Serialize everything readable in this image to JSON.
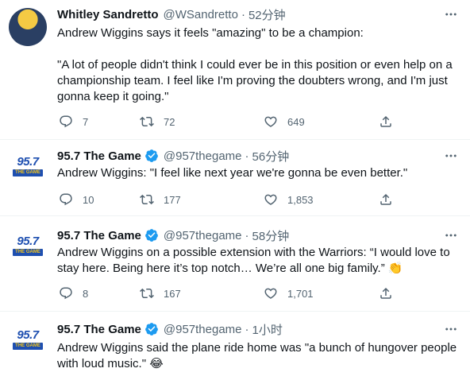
{
  "tweets": [
    {
      "name": "Whitley Sandretto",
      "handle": "@WSandretto",
      "separator": "·",
      "time": "52分钟",
      "text": "Andrew Wiggins says it feels \"amazing\" to be a champion:\n\n\"A lot of people didn't think I could ever be in this position or even help on a championship team. I feel like I'm proving the doubters wrong, and I'm just gonna keep it going.\"",
      "replies": "7",
      "retweets": "72",
      "likes": "649",
      "avatar_icon": "person-photo-avatar"
    },
    {
      "name": "95.7 The Game",
      "verified": true,
      "handle": "@957thegame",
      "separator": "·",
      "time": "56分钟",
      "text": "Andrew Wiggins: \"I feel like next year we're gonna be even better.\"",
      "replies": "10",
      "retweets": "177",
      "likes": "1,853",
      "avatar_logo_top": "95.7",
      "avatar_logo_bottom": "THE GAME"
    },
    {
      "name": "95.7 The Game",
      "verified": true,
      "handle": "@957thegame",
      "separator": "·",
      "time": "58分钟",
      "text": "Andrew Wiggins on a possible extension with the Warriors: “I would love to stay here. Being here it’s top notch… We’re all one big family.” 👏",
      "replies": "8",
      "retweets": "167",
      "likes": "1,701",
      "avatar_logo_top": "95.7",
      "avatar_logo_bottom": "THE GAME"
    },
    {
      "name": "95.7 The Game",
      "verified": true,
      "handle": "@957thegame",
      "separator": "·",
      "time": "1小时",
      "text": "Andrew Wiggins said the plane ride home was \"a bunch of hungover people with loud music.\" 😂",
      "avatar_logo_top": "95.7",
      "avatar_logo_bottom": "THE GAME"
    }
  ],
  "colors": {
    "text": "#0f1419",
    "secondary": "#536471",
    "verified": "#1d9bf0",
    "divider": "#eff3f4",
    "logo_blue": "#1e4fb0",
    "logo_yellow": "#f5c518"
  }
}
